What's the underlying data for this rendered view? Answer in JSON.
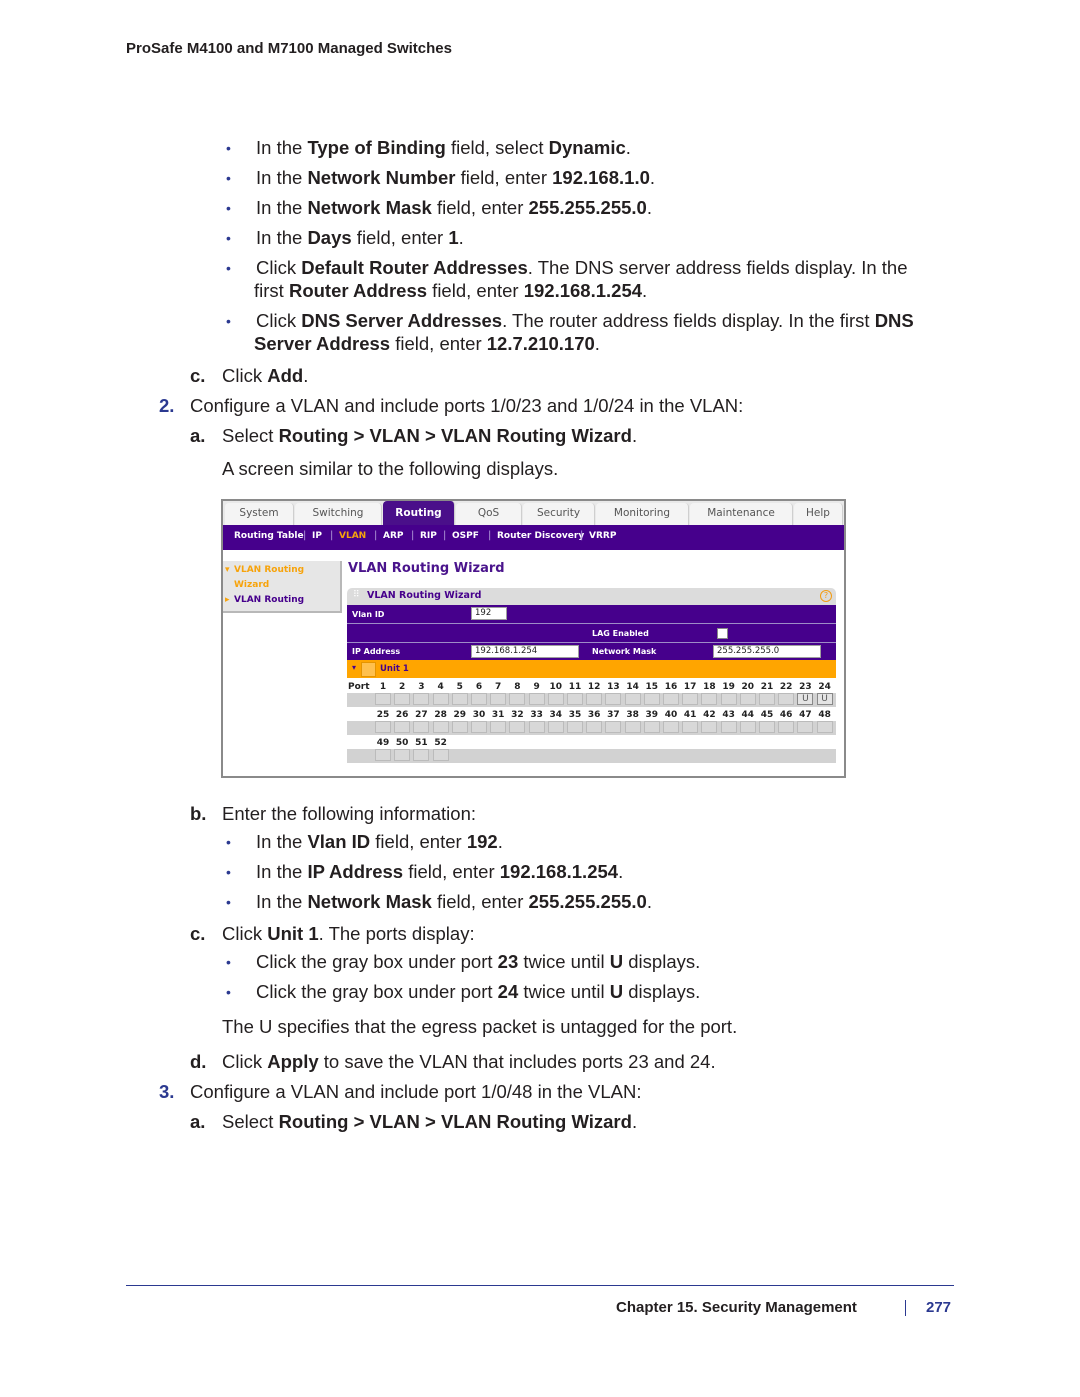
{
  "header": {
    "title": "ProSafe M4100 and M7100 Managed Switches"
  },
  "sections": {
    "bullets_top": [
      {
        "pre": "In the ",
        "b1": "Type of Binding",
        "mid": " field, select ",
        "b2": "Dynamic",
        "post": "."
      },
      {
        "pre": "In the ",
        "b1": "Network Number",
        "mid": " field, enter ",
        "b2": "192.168.1.0",
        "post": "."
      },
      {
        "pre": "In the ",
        "b1": "Network Mask",
        "mid": " field, enter ",
        "b2": "255.255.255.0",
        "post": "."
      },
      {
        "pre": "In the ",
        "b1": "Days",
        "mid": " field, enter ",
        "b2": "1",
        "post": "."
      }
    ],
    "bullet_router": {
      "l1_pre": "Click ",
      "l1_b": "Default Router Addresses",
      "l1_post": ". The DNS server address fields display. In the",
      "l2_pre": "first ",
      "l2_b1": "Router Address",
      "l2_mid": " field, enter ",
      "l2_b2": "192.168.1.254",
      "l2_post": "."
    },
    "bullet_dns": {
      "l1_pre": "Click ",
      "l1_b": "DNS Server Addresses",
      "l1_mid": ". The router address fields display. In the first ",
      "l1_b2": "DNS",
      "l2_b1": "Server Address",
      "l2_mid": " field, enter ",
      "l2_b2": "12.7.210.170",
      "l2_post": "."
    },
    "step_1c": {
      "letter": "c.",
      "pre": "Click ",
      "b": "Add",
      "post": "."
    },
    "step_2": {
      "num": "2.",
      "text": "Configure a VLAN and include ports 1/0/23 and 1/0/24 in the VLAN:"
    },
    "step_2a": {
      "letter": "a.",
      "pre": "Select ",
      "b": "Routing > VLAN > VLAN Routing Wizard",
      "post": "."
    },
    "step_2a_note": "A screen similar to the following displays.",
    "step_2b": {
      "letter": "b.",
      "text": "Enter the following information:"
    },
    "bullets_2b": [
      {
        "pre": "In the ",
        "b1": "Vlan ID",
        "mid": " field, enter ",
        "b2": "192",
        "post": "."
      },
      {
        "pre": "In the ",
        "b1": "IP Address",
        "mid": " field, enter ",
        "b2": "192.168.1.254",
        "post": "."
      },
      {
        "pre": "In the ",
        "b1": "Network Mask",
        "mid": " field, enter ",
        "b2": "255.255.255.0",
        "post": "."
      }
    ],
    "step_2c": {
      "letter": "c.",
      "pre": "Click ",
      "b": "Unit 1",
      "post": ". The ports display:"
    },
    "bullets_2c": [
      {
        "pre": "Click the gray box under port ",
        "b1": "23",
        "mid": " twice until ",
        "b2": "U",
        "post": " displays."
      },
      {
        "pre": "Click the gray box under port ",
        "b1": "24",
        "mid": " twice until ",
        "b2": "U",
        "post": " displays."
      }
    ],
    "step_2c_note": "The U specifies that the egress packet is untagged for the port.",
    "step_2d": {
      "letter": "d.",
      "pre": "Click ",
      "b": "Apply",
      "post": " to save the VLAN that includes ports 23 and 24."
    },
    "step_3": {
      "num": "3.",
      "text": "Configure a VLAN and include port 1/0/48 in the VLAN:"
    },
    "step_3a": {
      "letter": "a.",
      "pre": "Select ",
      "b": "Routing > VLAN > VLAN Routing Wizard",
      "post": "."
    }
  },
  "screenshot": {
    "tabs": [
      "System",
      "Switching",
      "Routing",
      "QoS",
      "Security",
      "Monitoring",
      "Maintenance",
      "Help"
    ],
    "active_tab": "Routing",
    "subnav": [
      "Routing Table",
      "IP",
      "VLAN",
      "ARP",
      "RIP",
      "OSPF",
      "Router Discovery",
      "VRRP"
    ],
    "active_subnav": "VLAN",
    "leftnav": {
      "item1_line1": "VLAN Routing",
      "item1_line2": "Wizard",
      "item2": "VLAN Routing"
    },
    "page_title": "VLAN Routing Wizard",
    "panel_title": "VLAN Routing Wizard",
    "help_icon": "?",
    "fields": {
      "vlan_id_label": "Vlan ID",
      "vlan_id_value": "192",
      "lag_label": "LAG Enabled",
      "lag_checked": false,
      "ip_label": "IP Address",
      "ip_value": "192.168.1.254",
      "mask_label": "Network Mask",
      "mask_value": "255.255.255.0"
    },
    "unit_label": "Unit 1",
    "port_label": "Port",
    "ports_row1": [
      "1",
      "2",
      "3",
      "4",
      "5",
      "6",
      "7",
      "8",
      "9",
      "10",
      "11",
      "12",
      "13",
      "14",
      "15",
      "16",
      "17",
      "18",
      "19",
      "20",
      "21",
      "22",
      "23",
      "24"
    ],
    "ports_row2": [
      "25",
      "26",
      "27",
      "28",
      "29",
      "30",
      "31",
      "32",
      "33",
      "34",
      "35",
      "36",
      "37",
      "38",
      "39",
      "40",
      "41",
      "42",
      "43",
      "44",
      "45",
      "46",
      "47",
      "48"
    ],
    "ports_row3": [
      "49",
      "50",
      "51",
      "52"
    ],
    "port_states": {
      "23": "U",
      "24": "U"
    }
  },
  "footer": {
    "chapter": "Chapter 15.  Security Management",
    "page": "277"
  },
  "colors": {
    "accent_blue": "#2b3990",
    "nav_purple": "#46008c",
    "unit_orange": "#ffa500",
    "active_orange": "#f7a30b"
  }
}
